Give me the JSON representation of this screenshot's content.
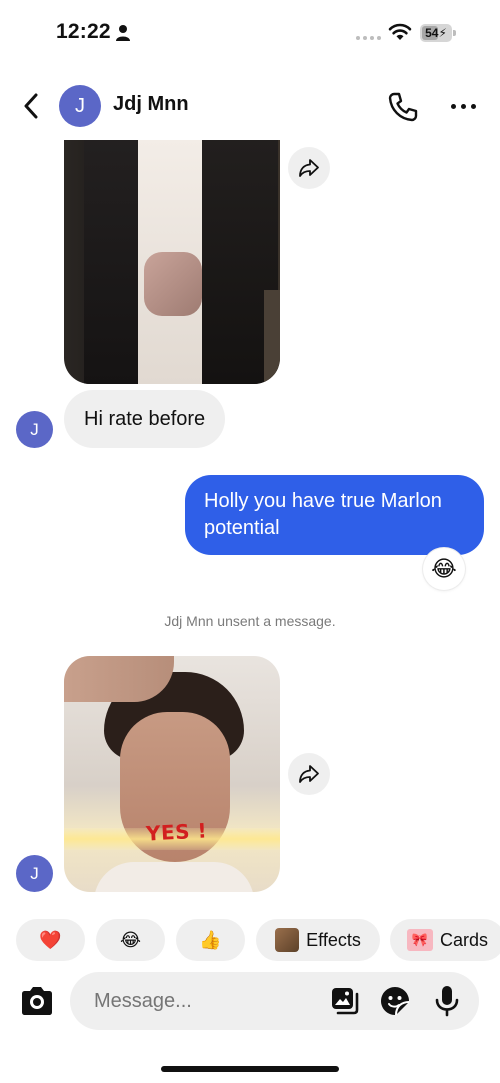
{
  "status_bar": {
    "time": "12:22",
    "battery": "54",
    "icons": [
      "person-icon",
      "signal-dots-icon",
      "wifi-icon",
      "battery-icon"
    ]
  },
  "header": {
    "avatar_initial": "J",
    "contact_name": "Jdj Mnn",
    "icons": [
      "back-chevron-icon",
      "phone-icon",
      "more-dots-icon"
    ]
  },
  "messages": [
    {
      "type": "image",
      "direction": "incoming",
      "description_icon": "photo"
    },
    {
      "type": "text",
      "direction": "incoming",
      "text": "Hi rate before",
      "avatar_initial": "J"
    },
    {
      "type": "text",
      "direction": "outgoing",
      "text": "Holly you have true Marlon potential",
      "reaction": "😂"
    },
    {
      "type": "system",
      "text": "Jdj Mnn unsent a message."
    },
    {
      "type": "image",
      "direction": "incoming",
      "avatar_initial": "J",
      "overlay_text": "YES !"
    }
  ],
  "quick_reactions": {
    "heart": "❤️",
    "laugh": "😂",
    "thumbs": "👍",
    "effects_label": "Effects",
    "cards_label": "Cards"
  },
  "composer": {
    "placeholder": "Message..."
  },
  "colors": {
    "accent": "#2f5fe8",
    "avatar": "#5b67c7",
    "bubble_in": "#efefef"
  }
}
